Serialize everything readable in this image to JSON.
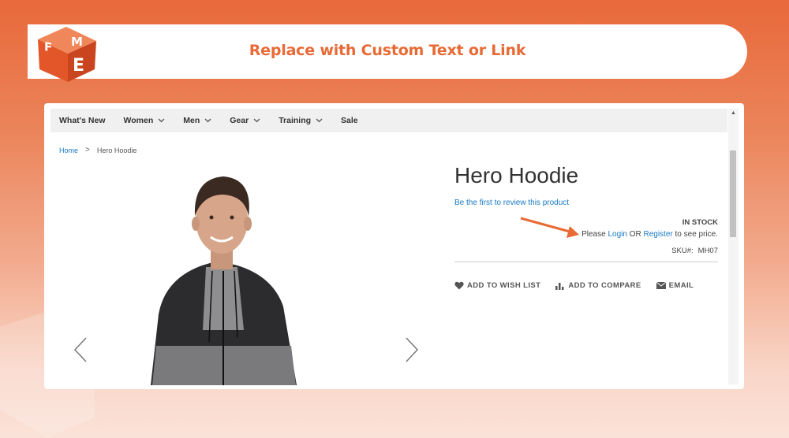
{
  "banner": {
    "title": "Replace with Custom Text or Link",
    "logo": "FME"
  },
  "colors": {
    "accent": "#e86a35",
    "link": "#1979c3"
  },
  "nav": {
    "items": [
      {
        "label": "What's New",
        "dropdown": false
      },
      {
        "label": "Women",
        "dropdown": true
      },
      {
        "label": "Men",
        "dropdown": true
      },
      {
        "label": "Gear",
        "dropdown": true
      },
      {
        "label": "Training",
        "dropdown": true
      },
      {
        "label": "Sale",
        "dropdown": false
      }
    ]
  },
  "breadcrumb": {
    "home": "Home",
    "separator": ">",
    "current": "Hero Hoodie"
  },
  "product": {
    "title": "Hero Hoodie",
    "review_link": "Be the first to review this product",
    "stock": "IN STOCK",
    "price_msg": {
      "before": "Please ",
      "login": "Login",
      "middle": " OR ",
      "register": "Register",
      "after": " to see price."
    },
    "sku_label": "SKU#:",
    "sku_value": "MH07"
  },
  "actions": {
    "wishlist": "ADD TO WISH LIST",
    "compare": "ADD TO COMPARE",
    "email": "EMAIL"
  },
  "icons": [
    "heart-icon",
    "bar-chart-icon",
    "envelope-icon",
    "chevron-down-icon",
    "chevron-left-icon",
    "chevron-right-icon"
  ]
}
